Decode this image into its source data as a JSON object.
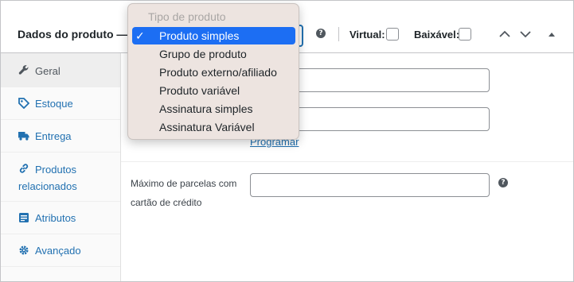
{
  "header": {
    "title": "Dados do produto —",
    "virtual_label": "Virtual:",
    "downloadable_label": "Baixável:",
    "help_glyph": "?"
  },
  "sidebar": {
    "items": [
      {
        "label": "Geral",
        "icon": "wrench-icon",
        "active": true
      },
      {
        "label": "Estoque",
        "icon": "tag-icon",
        "active": false
      },
      {
        "label": "Entrega",
        "icon": "truck-icon",
        "active": false
      },
      {
        "label_line1": "Produtos",
        "label_line2": "relacionados",
        "icon": "link-icon",
        "active": false
      },
      {
        "label": "Atributos",
        "icon": "list-icon",
        "active": false
      },
      {
        "label": "Avançado",
        "icon": "gear-icon",
        "active": false
      }
    ]
  },
  "main": {
    "schedule_link": "Programar",
    "installments_label": "Máximo de parcelas com cartão de crédito",
    "installments_value": "",
    "help_glyph": "?"
  },
  "dropdown": {
    "group_label": "Tipo de produto",
    "selected_index": 0,
    "check_glyph": "✓",
    "options": [
      "Produto simples",
      "Grupo de produto",
      "Produto externo/afiliado",
      "Produto variável",
      "Assinatura simples",
      "Assinatura Variável"
    ]
  },
  "colors": {
    "accent": "#2271b1",
    "selected": "#1c6ef3",
    "border": "#c3c4c7"
  }
}
